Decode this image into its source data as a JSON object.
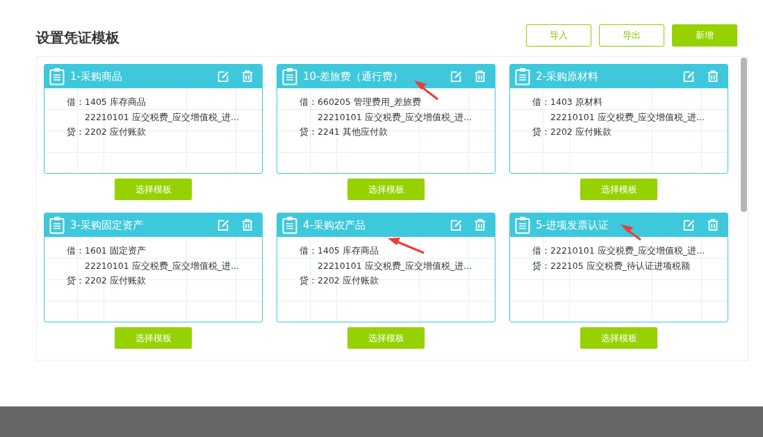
{
  "title": "设置凭证模板",
  "toolbar": [
    {
      "label": "导入",
      "kind": "outline"
    },
    {
      "label": "导出",
      "kind": "outline"
    },
    {
      "label": "新增",
      "kind": "solid"
    }
  ],
  "templates": [
    {
      "name": "1-采购商品",
      "lines": [
        {
          "side": "借：",
          "account": "1405 库存商品"
        },
        {
          "account": "22210101 应交税费_应交增值税_进..."
        },
        {
          "side": "贷：",
          "account": "2202 应付账款"
        }
      ],
      "button": "选择模板"
    },
    {
      "name": "10-差旅费（通行费）",
      "lines": [
        {
          "side": "借：",
          "account": "660205 管理费用_差旅费"
        },
        {
          "account": "22210101 应交税费_应交增值税_进..."
        },
        {
          "side": "贷：",
          "account": "2241 其他应付款"
        }
      ],
      "button": "选择模板"
    },
    {
      "name": "2-采购原材料",
      "lines": [
        {
          "side": "借：",
          "account": "1403 原材料"
        },
        {
          "account": "22210101 应交税费_应交增值税_进..."
        },
        {
          "side": "贷：",
          "account": "2202 应付账款"
        }
      ],
      "button": "选择模板"
    },
    {
      "name": "3-采购固定资产",
      "lines": [
        {
          "side": "借：",
          "account": "1601 固定资产"
        },
        {
          "account": "22210101 应交税费_应交增值税_进..."
        },
        {
          "side": "贷：",
          "account": "2202 应付账款"
        }
      ],
      "button": "选择模板"
    },
    {
      "name": "4-采购农产品",
      "lines": [
        {
          "side": "借：",
          "account": "1405 库存商品"
        },
        {
          "account": "22210101 应交税费_应交增值税_进..."
        },
        {
          "side": "贷：",
          "account": "2202 应付账款"
        }
      ],
      "button": "选择模板"
    },
    {
      "name": "5-进项发票认证",
      "lines": [
        {
          "side": "借：",
          "account": "22210101 应交税费_应交增值税_进..."
        },
        {
          "side": "贷：",
          "account": "222105 应交税费_待认证进项税额"
        }
      ],
      "button": "选择模板"
    }
  ]
}
